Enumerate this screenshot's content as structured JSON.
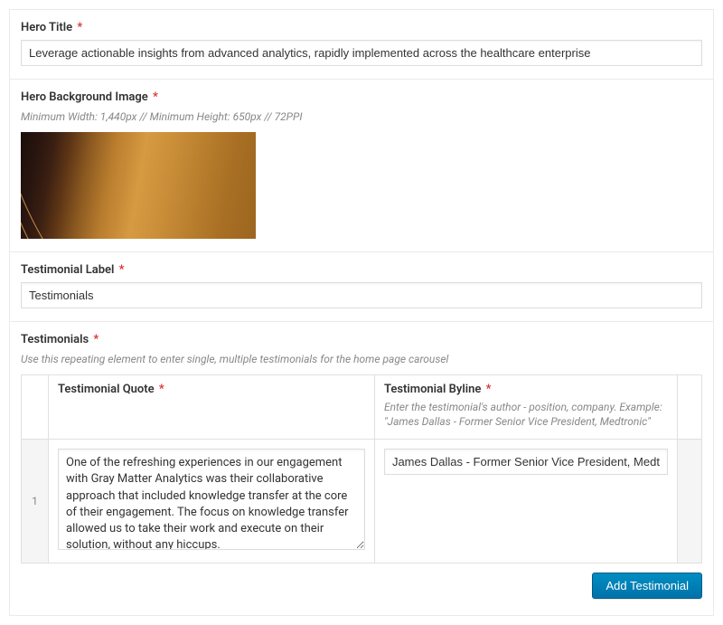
{
  "hero_title": {
    "label": "Hero Title",
    "value": "Leverage actionable insights from advanced analytics, rapidly implemented across the healthcare enterprise"
  },
  "hero_bg": {
    "label": "Hero Background Image",
    "instructions": "Minimum Width: 1,440px // Minimum Height: 650px // 72PPI"
  },
  "testimonial_label": {
    "label": "Testimonial Label",
    "value": "Testimonials"
  },
  "testimonials_section": {
    "label": "Testimonials",
    "instructions": "Use this repeating element to enter single, multiple testimonials for the home page carousel",
    "headers": {
      "quote": "Testimonial Quote",
      "byline": "Testimonial Byline",
      "byline_instructions": "Enter the testimonial's author - position, company. Example: \"James Dallas - Former Senior Vice President, Medtronic\""
    },
    "rows": [
      {
        "order": "1",
        "quote": "One of the refreshing experiences in our engagement with Gray Matter Analytics was their collaborative approach that included knowledge transfer at the core of their engagement. The focus on knowledge transfer allowed us to take their work and execute on their solution, without any hiccups.",
        "byline": "James Dallas - Former Senior Vice President, Medtronic"
      }
    ]
  },
  "buttons": {
    "add_testimonial": "Add Testimonial"
  },
  "required_marker": "*"
}
